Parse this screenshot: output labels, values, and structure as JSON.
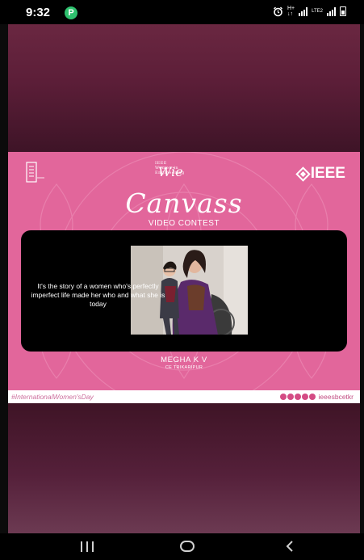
{
  "status_bar": {
    "time": "9:32",
    "app_badge": "P",
    "network": "LTE2"
  },
  "poster": {
    "logo_wie": "Wie",
    "logo_wie_small": "IEEE Women in Engineering",
    "logo_ieee": "IEEE",
    "title": "Canvass",
    "subtitle": "VIDEO CONTEST",
    "quote": "It's the story of a women who's perfectly imperfect life made her who and what she is today",
    "person_name": "MEGHA K V",
    "person_college": "CE TRIKARIPUR"
  },
  "footer": {
    "hashtag": "#InternationalWomen'sDay",
    "handle": "ieeesbcetkr"
  },
  "colors": {
    "poster_pink": "#e2669b",
    "frame_maroon": "#5c1e38",
    "status_badge_green": "#2ec16e"
  }
}
